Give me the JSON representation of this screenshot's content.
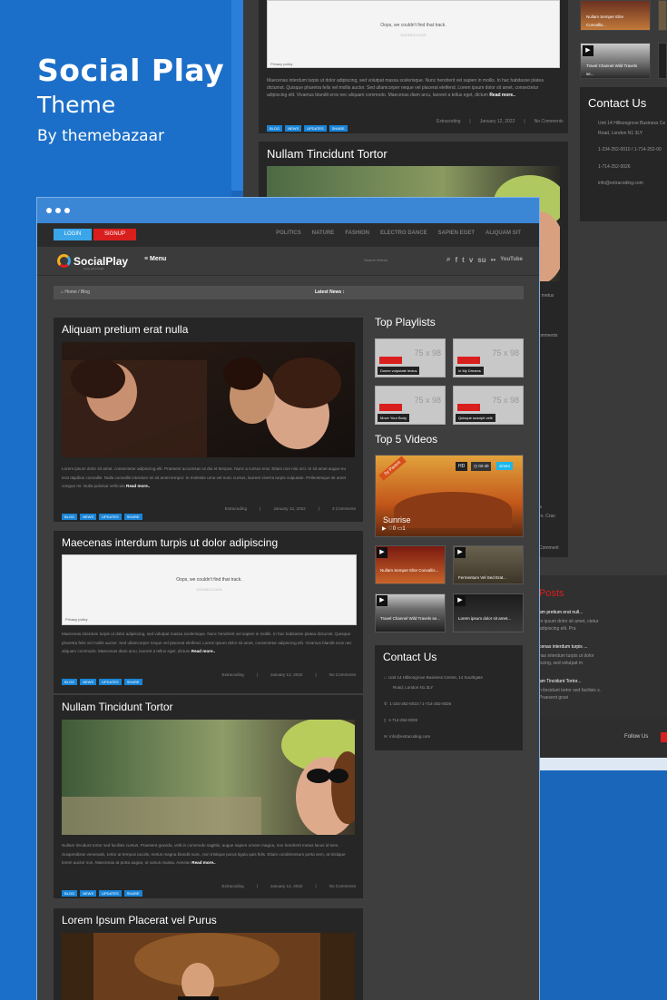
{
  "promo": {
    "title": "Social Play",
    "subtitle": "Theme",
    "author": "By themebazaar"
  },
  "back_shot": {
    "soundcloud_msg": "Oops, we couldn't find that track.",
    "soundcloud_brand": "SOUNDCLOUD",
    "privacy": "Privacy policy",
    "excerpt": "Maecenas interdum turpis ut dolor adipiscing, sed volutpat massa scelerisque. Nunc hendrerit vel sapien in mollis. In hac habitasse platea dictumst. Quisque pharetra felis vel mollis auctor. Sed ullamcorper neque vel placerat eleifend. Lorem ipsum dolor sit amet, consectetur adipiscing elit. Vivamus blandit eros nec aliquam commodo. Maecenas diam arcu, laoreet a tellus eget, dictum",
    "read_more": "Read more..",
    "tags": [
      "BLOG",
      "NEWS",
      "UPDATES",
      "SHARE"
    ],
    "meta": [
      "Extracoding",
      "|",
      "January 12, 2022",
      "|",
      "No Comments"
    ],
    "post_title": "Nullam Tincidunt Tortor",
    "video_captions": [
      "Nullam Semper Elite Convallis...",
      "Travel Channel Wild Travels se..."
    ],
    "contact_title": "Contact Us",
    "contact_lines": [
      "Unit 14 Hillsongrove Business Ce",
      "Road, London N1 3LY",
      "1-234-252-0010 / 1-714-252-00",
      "1-714-252-0026",
      "info@extracoding.com"
    ],
    "fragments": [
      "t metus",
      "omments",
      "a",
      "ro. Cras",
      "Comment"
    ],
    "posts_label": "Posts",
    "recent": [
      {
        "title": "am pretium erat null...",
        "text": "m ipsum dolor sit amet, ctetur adipiscing elit. Pra"
      },
      {
        "title": "cenas interdum turpis ...",
        "text": "nas interdum turpis ut dolor iscing, sed volutpat m"
      },
      {
        "title": "am Tincidunt Tortor...",
        "text": "n tincidunt tortor sed facilisis s. Praesent gravi"
      }
    ],
    "follow": "Follow Us"
  },
  "window": {
    "login": "LOGIN",
    "signup": "SIGNUP",
    "categories": [
      "POLITICS",
      "NATURE",
      "FASHION",
      "ELECTRO DANCE",
      "SAPIEN EGET",
      "ALIQUAM SIT"
    ],
    "logo": "SocialPlay",
    "logo_sub": "enjoy your music",
    "menu": "Menu",
    "search_placeholder": "Search Videos",
    "socials": [
      "f",
      "t",
      "v",
      "su",
      "••",
      "YouTube"
    ],
    "breadcrumb": [
      "Home",
      "/",
      "Blog"
    ],
    "latest_news": "Latest News :"
  },
  "posts": [
    {
      "title": "Aliquam pretium erat nulla",
      "excerpt": "Lorem ipsum dolor sit amet, consectetur adipiscing elit. Praesent accumsan ut dui et tempus. Nunc a cursus erat. Etiam non nisi orci. In sit amet augue eu erat dapibus convallis. Nulla convallis interdum mi sit amet tempor. In molestie urna vel nunc cursus, laoreet viverra turpis vulputate. Pellentesque sit amet congue mi. Nulla pulvinar vehicula",
      "read_more": "Read more..",
      "tags": [
        "BLOG",
        "NEWS",
        "UPDATES",
        "SHARE"
      ],
      "author": "Extracoding",
      "date": "January 12, 2022",
      "comments": "3 Comments"
    },
    {
      "title": "Maecenas interdum turpis ut dolor adipiscing",
      "soundcloud_msg": "Oops, we couldn't find that track.",
      "soundcloud_brand": "SOUNDCLOUD",
      "privacy": "Privacy policy",
      "excerpt": "Maecenas interdum turpis ut dolor adipiscing, sed volutpat massa scelerisque. Nunc hendrerit vel sapien in mollis. In hac habitasse platea dictumst. Quisque pharetra felis vel mollis auctor. Sed ullamcorper neque vel placerat eleifend. Lorem ipsum dolor sit amet, consectetur adipiscing elit. Vivamus blandit eros nec aliquam commodo. Maecenas diam arcu, laoreet a tellus eget, dictum",
      "read_more": "Read more..",
      "tags": [
        "BLOG",
        "NEWS",
        "UPDATES",
        "SHARE"
      ],
      "author": "Extracoding",
      "date": "January 12, 2022",
      "comments": "No Comments"
    },
    {
      "title": "Nullam Tincidunt Tortor",
      "excerpt": "Nullam tincidunt tortor sed facilisis cursus. Praesent gravida, velit in commodo sagittis, augue sapien ornare magna, non hendrerit metus lacus id sem. Suspendisse venenatis, tortor at tempus iaculis, metus magna blandit nunc, non tristique purus ligula quis felis. Etiam condimentum porta sem, at tristique lorem auctor non. Maecenas at porta augue, ut varius massa. Aenean",
      "read_more": "Read more..",
      "tags": [
        "BLOG",
        "NEWS",
        "UPDATES",
        "SHARE"
      ],
      "author": "Extracoding",
      "date": "January 12, 2022",
      "comments": "No Comments"
    },
    {
      "title": "Lorem Ipsum Placerat vel Purus"
    }
  ],
  "sidebar": {
    "playlists_title": "Top Playlists",
    "thumb_dim": "75 x 98",
    "playlists": [
      "Donec vulputate lectus",
      "In My Dreams",
      "Move Your Body",
      "Quisque suscipit velit"
    ],
    "videos_title": "Top 5 Videos",
    "featured": {
      "title": "Sunrise",
      "hd": "HD",
      "time": "02:40",
      "vimeo": "vimeo",
      "ribbon": "by Parent",
      "likes": "0",
      "comments": "1"
    },
    "videos": [
      "Nullam Semper Elite Convallis...",
      "Fermentum Vel Sed Erat...",
      "Travel Channel Wild Travels se...",
      "Lorem ipsum dolor sit amet..."
    ],
    "contact_title": "Contact Us",
    "contact": [
      "Unit 14 Hillsongrove Business Centre, 14 Southgate",
      "Road, London N1 3LY",
      "1-234-252-0010 / 1-714-252-0026",
      "1-714-252-0026",
      "info@extracoding.com"
    ]
  }
}
